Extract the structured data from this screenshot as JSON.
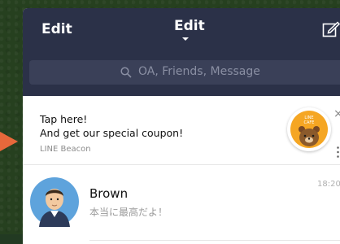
{
  "header": {
    "left_label": "Edit",
    "title": "Edit",
    "title_dropdown_icon": "caret-down-icon",
    "compose_icon": "compose-icon"
  },
  "search": {
    "placeholder": "OA, Friends, Message",
    "icon": "search-icon"
  },
  "banner": {
    "line1": "Tap here!",
    "line2": "And get our special coupon!",
    "source": "LINE Beacon",
    "badge": {
      "text_top": "LINE",
      "text_bottom": "CAFE",
      "icon": "brown-bear-icon",
      "color": "#f5a623"
    },
    "close_symbol": "×",
    "more_icon": "more-vertical-icon"
  },
  "chats": [
    {
      "name": "Brown",
      "preview": "本当に最高だよ！",
      "time": "18:20",
      "avatar_icon": "person-avatar-icon"
    }
  ],
  "colors": {
    "header_bg": "#2b3148",
    "search_bg": "#3a4058",
    "arrow": "#e7683b",
    "desktop_bg": "#26401f"
  }
}
